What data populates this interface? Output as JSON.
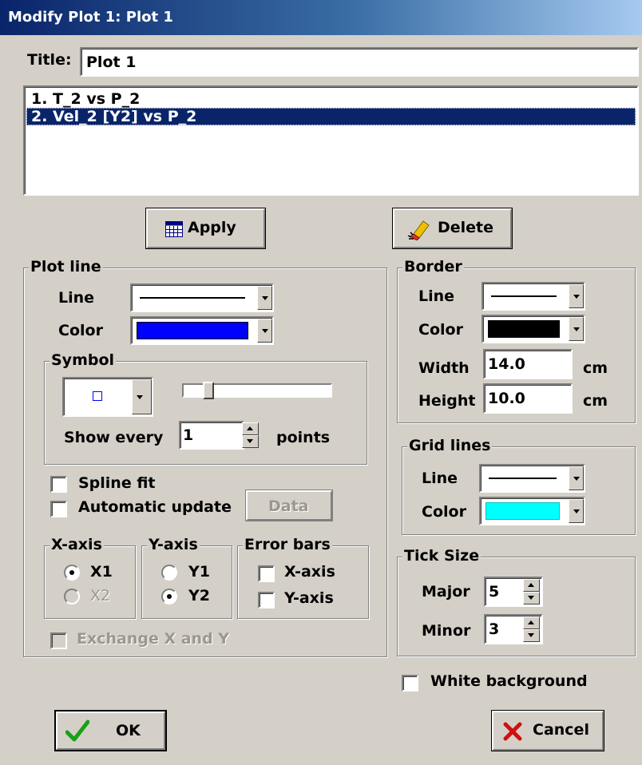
{
  "window": {
    "title": "Modify Plot 1: Plot 1"
  },
  "title_field": {
    "label": "Title:",
    "value": "Plot 1"
  },
  "plot_list": {
    "items": [
      "1.  T_2 vs P_2",
      "2.  Vel_2 [Y2] vs P_2"
    ],
    "selected_index": 1
  },
  "buttons": {
    "apply": "Apply",
    "delete": "Delete",
    "data": "Data",
    "ok": "OK",
    "cancel": "Cancel"
  },
  "plot_line": {
    "group_label": "Plot line",
    "line_label": "Line",
    "color_label": "Color",
    "color_value": "#0000ff",
    "symbol": {
      "group_label": "Symbol",
      "show_every_label": "Show every",
      "show_every_value": "1",
      "points_label": "points",
      "size_slider_level": 0.17
    },
    "spline_fit": {
      "label": "Spline fit",
      "checked": false
    },
    "automatic_update": {
      "label": "Automatic update",
      "checked": false
    },
    "x_axis": {
      "label": "X-axis",
      "options": [
        "X1",
        "X2"
      ],
      "selected": "X1"
    },
    "y_axis": {
      "label": "Y-axis",
      "options": [
        "Y1",
        "Y2"
      ],
      "selected": "Y2"
    },
    "error_bars": {
      "label": "Error bars",
      "x_label": "X-axis",
      "y_label": "Y-axis"
    },
    "exchange_xy": {
      "label": "Exchange X and Y",
      "enabled": false
    }
  },
  "border": {
    "group_label": "Border",
    "line_label": "Line",
    "color_label": "Color",
    "color_value": "#000000",
    "width_label": "Width",
    "width_value": "14.0",
    "height_label": "Height",
    "height_value": "10.0",
    "unit": "cm"
  },
  "grid_lines": {
    "group_label": "Grid lines",
    "line_label": "Line",
    "color_label": "Color",
    "color_value": "#00ffff"
  },
  "tick_size": {
    "group_label": "Tick Size",
    "major_label": "Major",
    "major_value": "5",
    "minor_label": "Minor",
    "minor_value": "3"
  },
  "white_background": {
    "label": "White background",
    "checked": false
  }
}
